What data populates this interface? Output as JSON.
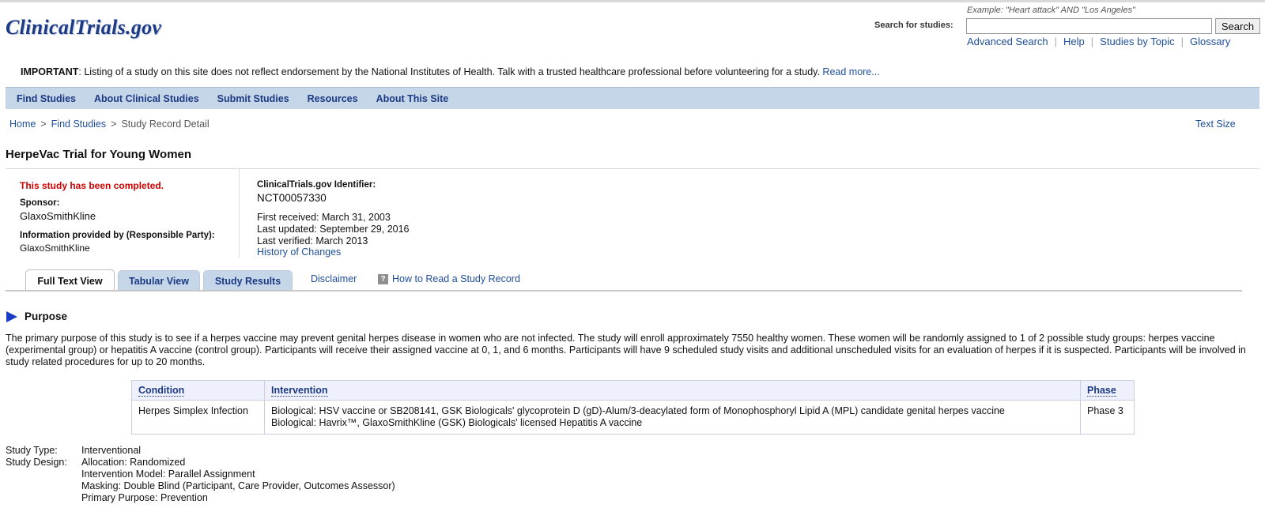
{
  "header": {
    "logo": "ClinicalTrials.gov",
    "search_example": "Example: \"Heart attack\" AND \"Los Angeles\"",
    "search_label": "Search for studies:",
    "search_value": "",
    "search_button": "Search",
    "links": [
      "Advanced Search",
      "Help",
      "Studies by Topic",
      "Glossary"
    ]
  },
  "notice": {
    "label": "IMPORTANT",
    "text": ": Listing of a study on this site does not reflect endorsement by the National Institutes of Health. Talk with a trusted healthcare professional before volunteering for a study. ",
    "link": "Read more..."
  },
  "nav": [
    "Find Studies",
    "About Clinical Studies",
    "Submit Studies",
    "Resources",
    "About This Site"
  ],
  "breadcrumb": {
    "items": [
      "Home",
      "Find Studies",
      "Study Record Detail"
    ],
    "separator": ">"
  },
  "text_size": "Text Size",
  "study": {
    "title": "HerpeVac Trial for Young Women",
    "status": "This study has been completed.",
    "sponsor_label": "Sponsor:",
    "sponsor": "GlaxoSmithKline",
    "info_label": "Information provided by (Responsible Party):",
    "info_value": "GlaxoSmithKline",
    "id_label": "ClinicalTrials.gov Identifier:",
    "id": "NCT00057330",
    "first_received": "First received: March 31, 2003",
    "last_updated": "Last updated: September 29, 2016",
    "last_verified": "Last verified: March 2013",
    "history_link": "History of Changes"
  },
  "tabs": {
    "full_text": "Full Text View",
    "tabular": "Tabular View",
    "results": "Study Results",
    "disclaimer": "Disclaimer",
    "help_icon": "?",
    "how_to": "How to Read a Study Record"
  },
  "purpose": {
    "heading": "Purpose",
    "text": "The primary purpose of this study is to see if a herpes vaccine may prevent genital herpes disease in women who are not infected. The study will enroll approximately 7550 healthy women. These women will be randomly assigned to 1 of 2 possible study groups: herpes vaccine (experimental group) or hepatitis A vaccine (control group). Participants will receive their assigned vaccine at 0, 1, and 6 months. Participants will have 9 scheduled study visits and additional unscheduled visits for an evaluation of herpes if it is suspected. Participants will be involved in study related procedures for up to 20 months."
  },
  "conditions_table": {
    "headers": [
      "Condition",
      "Intervention",
      "Phase"
    ],
    "condition": "Herpes Simplex Infection",
    "interventions": [
      "Biological: HSV vaccine or SB208141, GSK Biologicals' glycoprotein D (gD)-Alum/3-deacylated form of Monophosphoryl Lipid A (MPL) candidate genital herpes vaccine",
      "Biological: Havrix™, GlaxoSmithKline (GSK) Biologicals' licensed Hepatitis A vaccine"
    ],
    "phase": "Phase 3"
  },
  "design": {
    "type_label": "Study Type:",
    "type_value": "Interventional",
    "design_label": "Study Design:",
    "design_values": [
      "Allocation: Randomized",
      "Intervention Model: Parallel Assignment",
      "Masking: Double Blind (Participant, Care Provider, Outcomes Assessor)",
      "Primary Purpose: Prevention"
    ]
  },
  "colors": {
    "nav_bg": "#c6d6e9",
    "link": "#1f4f9a",
    "status_red": "#d00000",
    "brand": "#1c3a83"
  }
}
